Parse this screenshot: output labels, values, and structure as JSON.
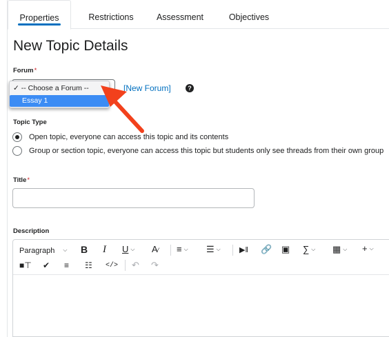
{
  "tabs": [
    {
      "label": "Properties",
      "active": true
    },
    {
      "label": "Restrictions",
      "active": false
    },
    {
      "label": "Assessment",
      "active": false
    },
    {
      "label": "Objectives",
      "active": false
    }
  ],
  "page_title": "New Topic Details",
  "forum": {
    "label": "Forum",
    "required_mark": "*",
    "options": [
      "-- Choose a Forum --",
      "Essay 1"
    ],
    "checked_mark": "✓",
    "highlighted_option": "Essay 1",
    "new_forum_link": "[New Forum]",
    "help_icon": "question-circle-icon"
  },
  "topic_type": {
    "label": "Topic Type",
    "options": [
      {
        "text": "Open topic, everyone can access this topic and its contents",
        "selected": true
      },
      {
        "text": "Group or section topic, everyone can access this topic but students only see threads from their own group",
        "selected": false
      }
    ]
  },
  "title_field": {
    "label": "Title",
    "required_mark": "*",
    "value": ""
  },
  "description": {
    "label": "Description",
    "toolbar": {
      "paragraph_label": "Paragraph",
      "bold": "B",
      "italic": "I",
      "underline": "U",
      "font_color": "A",
      "align_icon": "align-left-icon",
      "list_icon": "bullet-list-icon",
      "media_icon": "insert-media-icon",
      "link_icon": "link-icon",
      "image_icon": "image-icon",
      "equation": "∑",
      "table_icon": "table-icon",
      "plus": "+",
      "format_painter_icon": "format-painter-icon",
      "accessibility_icon": "accessibility-check-icon",
      "hr_icon": "horizontal-rule-icon",
      "preview_icon": "preview-icon",
      "source_code": "</>",
      "undo_icon": "undo-icon",
      "redo_icon": "redo-icon"
    }
  },
  "annotation": {
    "color": "#f2411c"
  },
  "colors": {
    "accent": "#006fbf",
    "dropdown_highlight": "#3c8cf4",
    "required": "#cd2026"
  }
}
